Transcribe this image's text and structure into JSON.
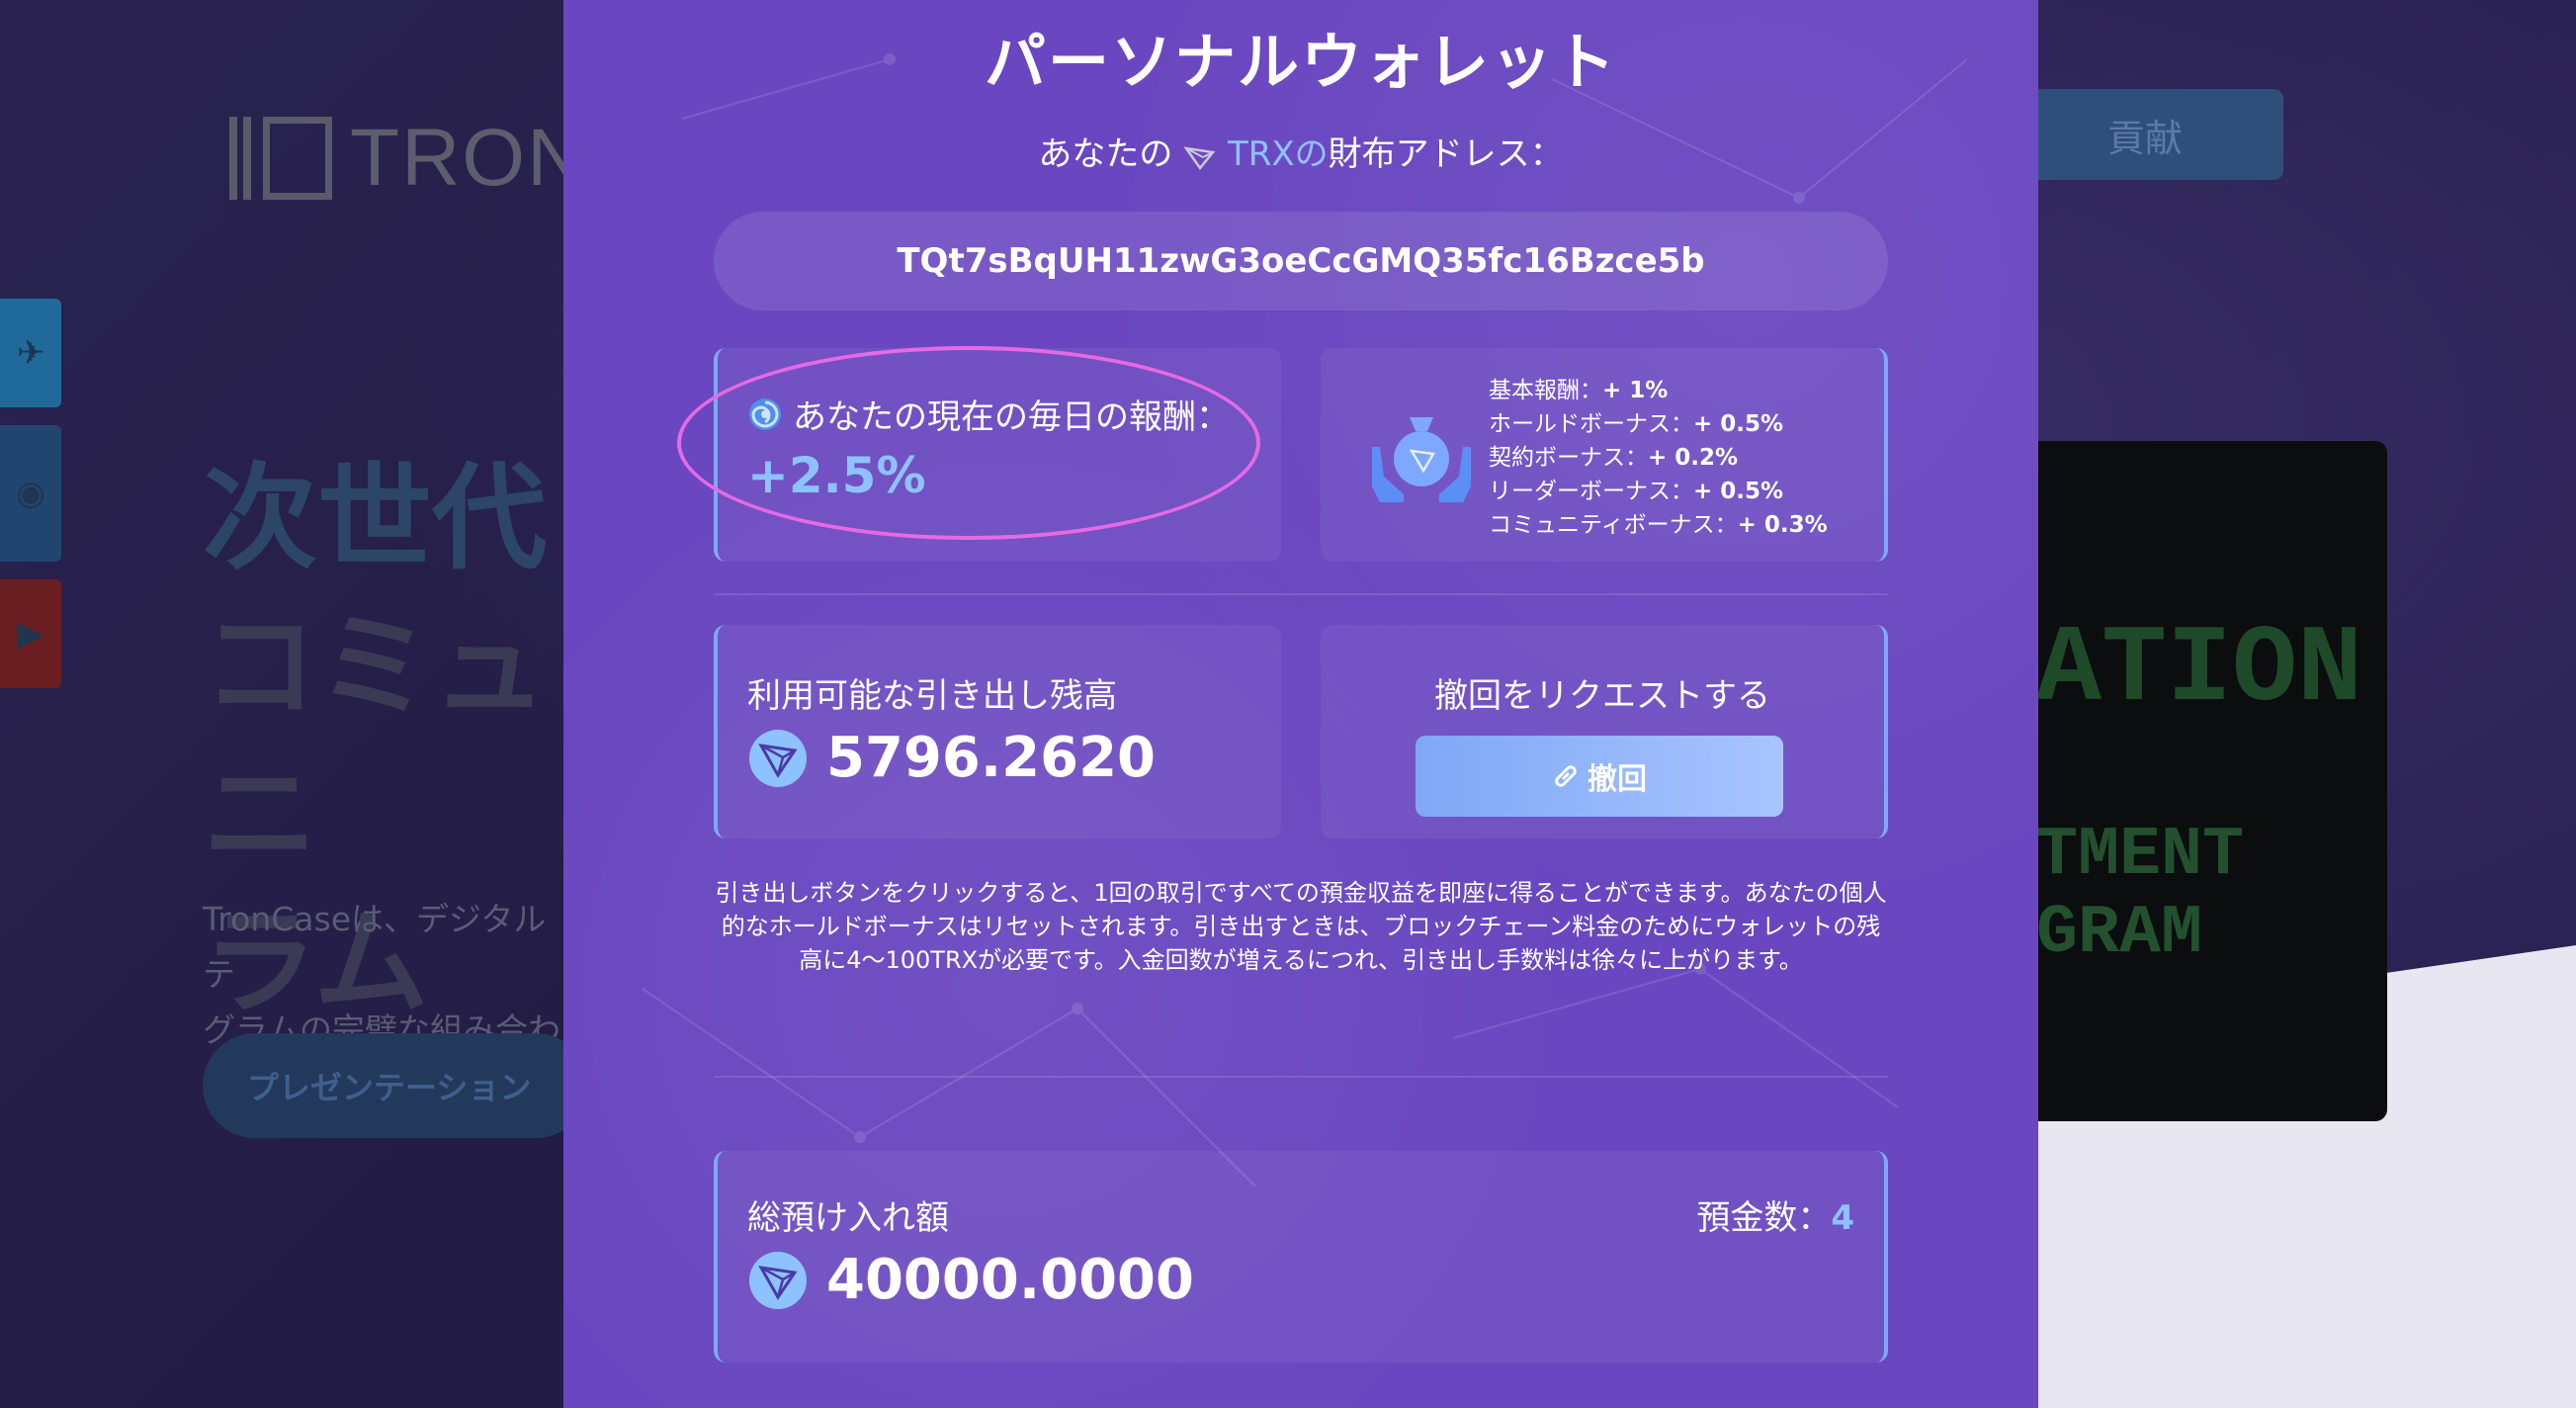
{
  "background": {
    "logo_text": "TRON",
    "nav_button": "貢献",
    "hero_line1": "次世代",
    "hero_line2": "コミュニ",
    "hero_line3": "ラム",
    "desc_line1": "TronCaseは、デジタルテ",
    "desc_line2": "グラムの完璧な組み合わせ",
    "present_button": "プレゼンテーション",
    "video_line1": "ATION",
    "video_line2": "TMENT GRAM"
  },
  "modal": {
    "title": "パーソナルウォレット",
    "address_label_pre": "あなたの",
    "address_label_trx": "TRXの",
    "address_label_post": "財布アドレス：",
    "address": "TQt7sBqUH11zwG3oeCcGMQ35fc16Bzce5b",
    "reward": {
      "label": "あなたの現在の毎日の報酬：",
      "value": "+2.5%"
    },
    "bonuses": [
      {
        "label": "基本報酬：",
        "value": "+ 1%"
      },
      {
        "label": "ホールドボーナス：",
        "value": "+ 0.5%"
      },
      {
        "label": "契約ボーナス：",
        "value": "+ 0.2%"
      },
      {
        "label": "リーダーボーナス：",
        "value": "+ 0.5%"
      },
      {
        "label": "コミュニティボーナス：",
        "value": "+ 0.3%"
      }
    ],
    "balance": {
      "label": "利用可能な引き出し残高",
      "value": "5796.2620"
    },
    "withdraw": {
      "title": "撤回をリクエストする",
      "button": "撤回"
    },
    "note": "引き出しボタンをクリックすると、1回の取引ですべての預金収益を即座に得ることができます。あなたの個人的なホールドボーナスはリセットされます。引き出すときは、ブロックチェーン料金のためにウォレットの残高に4〜100TRXが必要です。入金回数が増えるにつれ、引き出し手数料は徐々に上がります。",
    "deposit": {
      "label": "総預け入れ額",
      "value": "40000.0000",
      "count_label": "預金数：",
      "count": "4"
    }
  },
  "colors": {
    "modal_bg": "#6a47c0",
    "accent": "#8ec2ff",
    "card_border": "#7ea8ff",
    "highlight": "#e46ae6"
  }
}
